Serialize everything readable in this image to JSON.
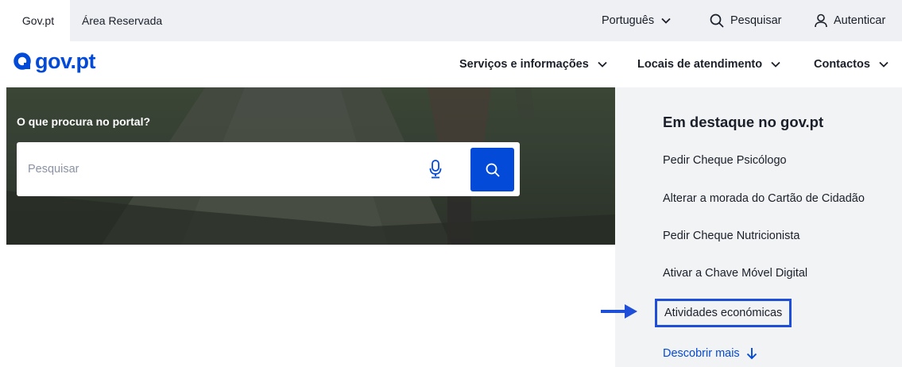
{
  "topbar": {
    "tabs": [
      {
        "label": "Gov.pt"
      },
      {
        "label": "Área Reservada"
      }
    ],
    "language": "Português",
    "search_label": "Pesquisar",
    "auth_label": "Autenticar"
  },
  "navbar": {
    "logo": "gov.pt",
    "items": [
      {
        "label": "Serviços e informações"
      },
      {
        "label": "Locais de atendimento"
      },
      {
        "label": "Contactos"
      }
    ]
  },
  "hero": {
    "title": "O que procura no portal?",
    "search": {
      "placeholder": "Pesquisar",
      "value": ""
    }
  },
  "featured": {
    "title": "Em destaque no gov.pt",
    "links": [
      {
        "label": "Pedir Cheque Psicólogo"
      },
      {
        "label": "Alterar a morada do Cartão de Cidadão"
      },
      {
        "label": "Pedir Cheque Nutricionista"
      },
      {
        "label": "Ativar a Chave Móvel Digital"
      },
      {
        "label": "Atividades económicas"
      }
    ],
    "more": "Descobrir mais"
  },
  "colors": {
    "brand": "#034ad8",
    "highlight": "#1f4ed8",
    "topbar_bg": "#eef0f4",
    "panel_bg": "#f2f3f5"
  }
}
